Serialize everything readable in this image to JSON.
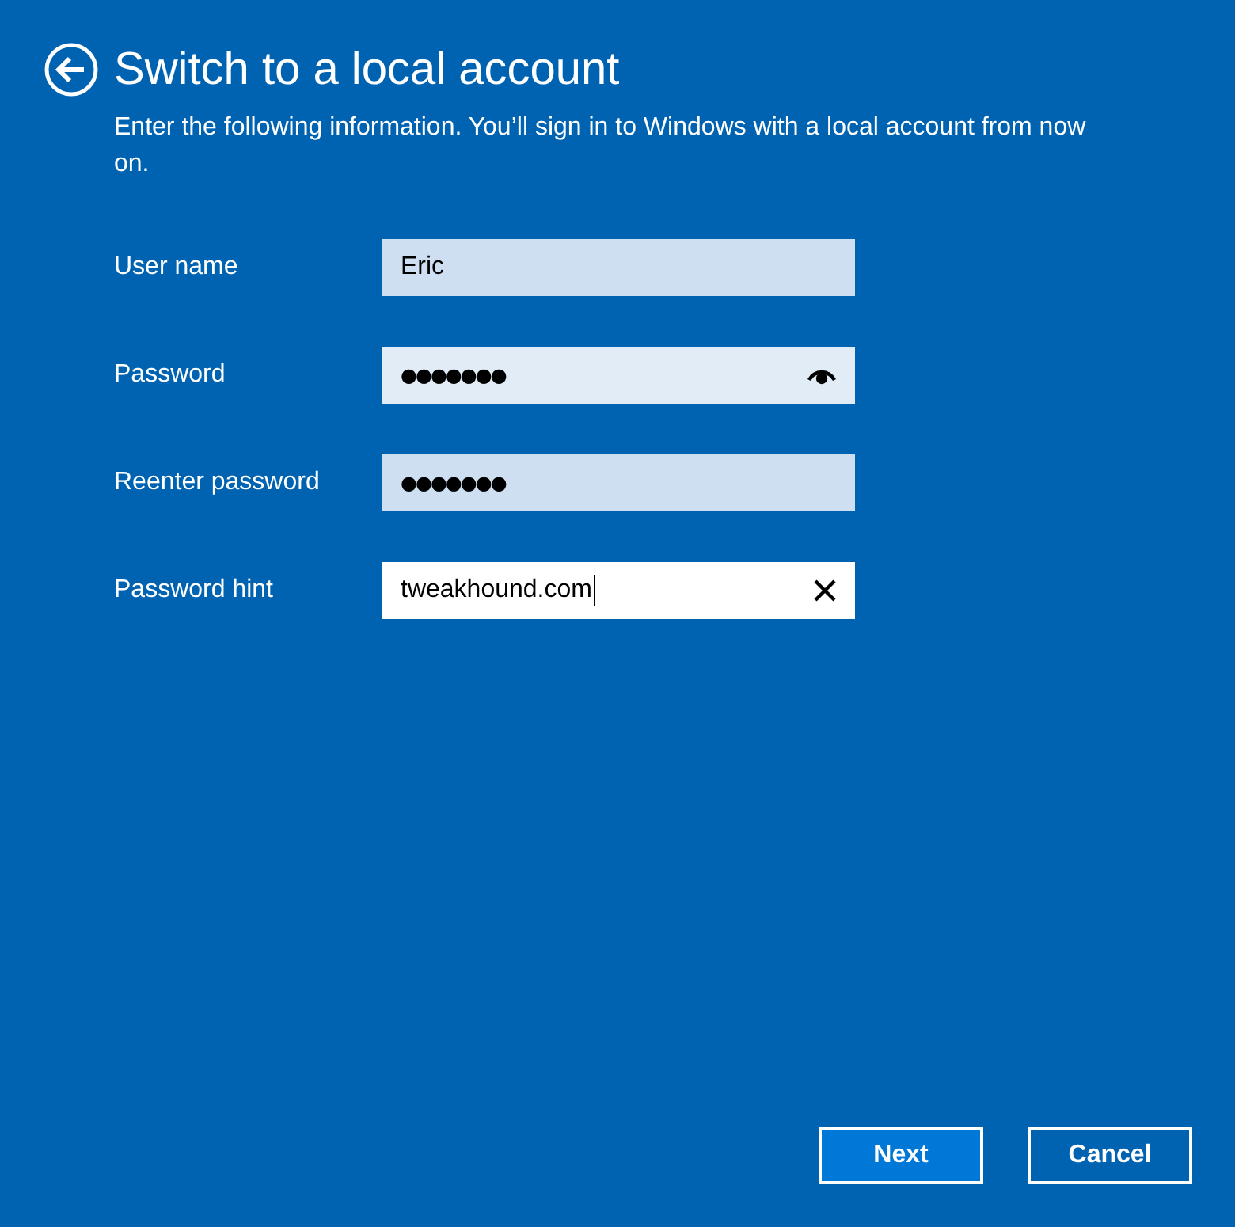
{
  "title": "Switch to a local account",
  "description": "Enter the following information. You’ll sign in to Windows with a local account from now on.",
  "fields": [
    {
      "label": "User name",
      "value": "Eric",
      "kind": "text",
      "hovered": false,
      "focused": false
    },
    {
      "label": "Password",
      "value": "●●●●●●●",
      "kind": "password",
      "hovered": true,
      "focused": false
    },
    {
      "label": "Reenter password",
      "value": "●●●●●●●",
      "kind": "password",
      "hovered": false,
      "focused": false
    },
    {
      "label": "Password hint",
      "value": "tweakhound.com",
      "kind": "clearable",
      "focused": true
    }
  ],
  "buttons": [
    {
      "label": "Next",
      "default": true
    },
    {
      "label": "Cancel",
      "default": false
    }
  ]
}
